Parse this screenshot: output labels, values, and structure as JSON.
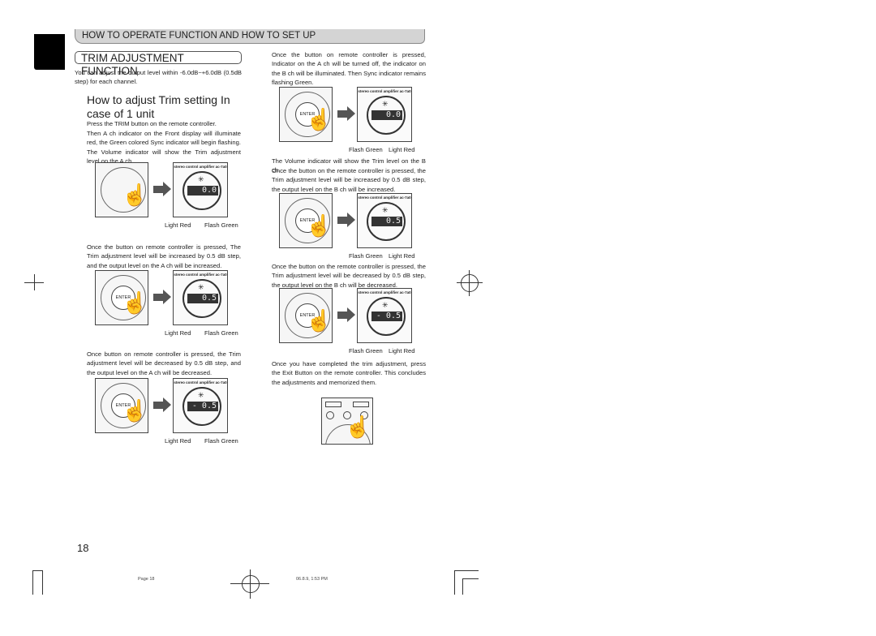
{
  "header": {
    "title": "HOW TO OPERATE FUNCTION AND HOW TO SET UP"
  },
  "section": {
    "title": "TRIM ADJUSTMENT FUNCTION"
  },
  "left": {
    "intro": "You can adjust the output level within -6.0dB~+6.0dB (0.5dB step) for each channel.",
    "subheading": "How to adjust Trim setting In case of 1 unit",
    "p1": "Press the TRIM button on the remote controller.",
    "p2": "Then A ch indicator on the Front display will illuminate red, the Green colored Sync indicator will begin flashing. The Volume indicator will show the Trim adjustment level on the A ch.",
    "p3": "Once the     button on remote controller is pressed, The Trim adjustment level will be increased by 0.5 dB step, and the output level on the A ch will be increased.",
    "p4": "Once     button on remote controller is pressed, the Trim adjustment level will be decreased by 0.5 dB step, and the output level on the A ch will be decreased."
  },
  "right": {
    "p1": "Once the     button on remote controller is pressed, Indicator on the A ch will be turned off, the indicator on the B ch will be illuminated.   Then Sync indicator remains flashing Green.",
    "p2": "The Volume indicator will show the Trim level on the B ch.",
    "p3": "Once the     button on the remote controller is pressed, the Trim adjustment level will be increased by 0.5 dB step, the output level on the B ch will be increased.",
    "p4": "Once the     button on the remote controller is pressed, the Trim adjustment level will be decreased by 0.5 dB step, the output level on the B ch will be decreased.",
    "p5": "Once you have completed the trim adjustment, press the Exit Button on the remote controller. This concludes the adjustments and memorized them."
  },
  "display_title": "stereo control amplifier ac-7a0",
  "enter_label": "ENTER",
  "figures": [
    {
      "value": "0.0",
      "labels": [
        "Light Red",
        "Flash Green"
      ],
      "enter": false
    },
    {
      "value": "0.5",
      "labels": [
        "Light Red",
        "Flash Green"
      ],
      "enter": true
    },
    {
      "value": "- 0.5",
      "labels": [
        "Light Red",
        "Flash Green"
      ],
      "enter": true
    },
    {
      "value": "0.0",
      "labels": [
        "Flash Green",
        "Light Red"
      ],
      "enter": true
    },
    {
      "value": "0.5",
      "labels": [
        "Flash Green",
        "Light Red"
      ],
      "enter": true
    },
    {
      "value": "- 0.5",
      "labels": [
        "Flash Green",
        "Light Red"
      ],
      "enter": true
    }
  ],
  "page_number": "18",
  "footer": {
    "page": "Page 18",
    "date": "06.8.9, 1:53 PM"
  }
}
